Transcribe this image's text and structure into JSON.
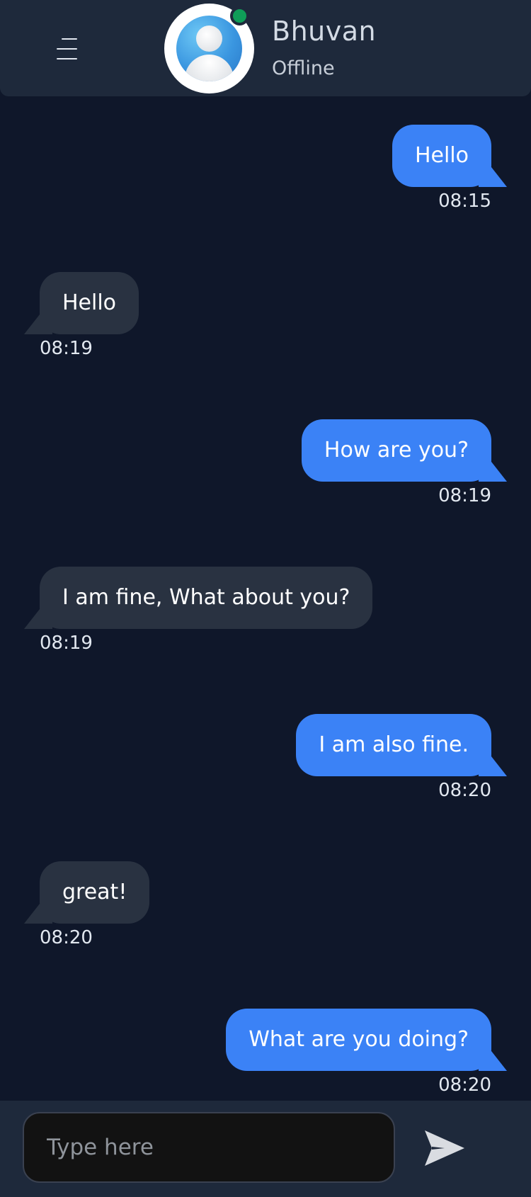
{
  "contact": {
    "name": "Bhuvan",
    "status": "Offline"
  },
  "messages": [
    {
      "direction": "sent",
      "text": "Hello",
      "time": "08:15"
    },
    {
      "direction": "received",
      "text": "Hello",
      "time": "08:19"
    },
    {
      "direction": "sent",
      "text": "How are you?",
      "time": "08:19"
    },
    {
      "direction": "received",
      "text": "I am fine, What about you?",
      "time": "08:19"
    },
    {
      "direction": "sent",
      "text": "I am also fine.",
      "time": "08:20"
    },
    {
      "direction": "received",
      "text": "great!",
      "time": "08:20"
    },
    {
      "direction": "sent",
      "text": "What are you doing?",
      "time": "08:20"
    }
  ],
  "composer": {
    "placeholder": "Type here",
    "value": ""
  },
  "icons": {
    "menu": "hamburger-menu-icon",
    "avatar": "user-avatar-icon",
    "presence": "online-dot-icon",
    "send": "send-arrow-icon"
  },
  "colors": {
    "background": "#0f172a",
    "header": "#1e293b",
    "sent_bubble": "#3b82f6",
    "received_bubble": "#293241",
    "presence": "#0f9d58"
  }
}
